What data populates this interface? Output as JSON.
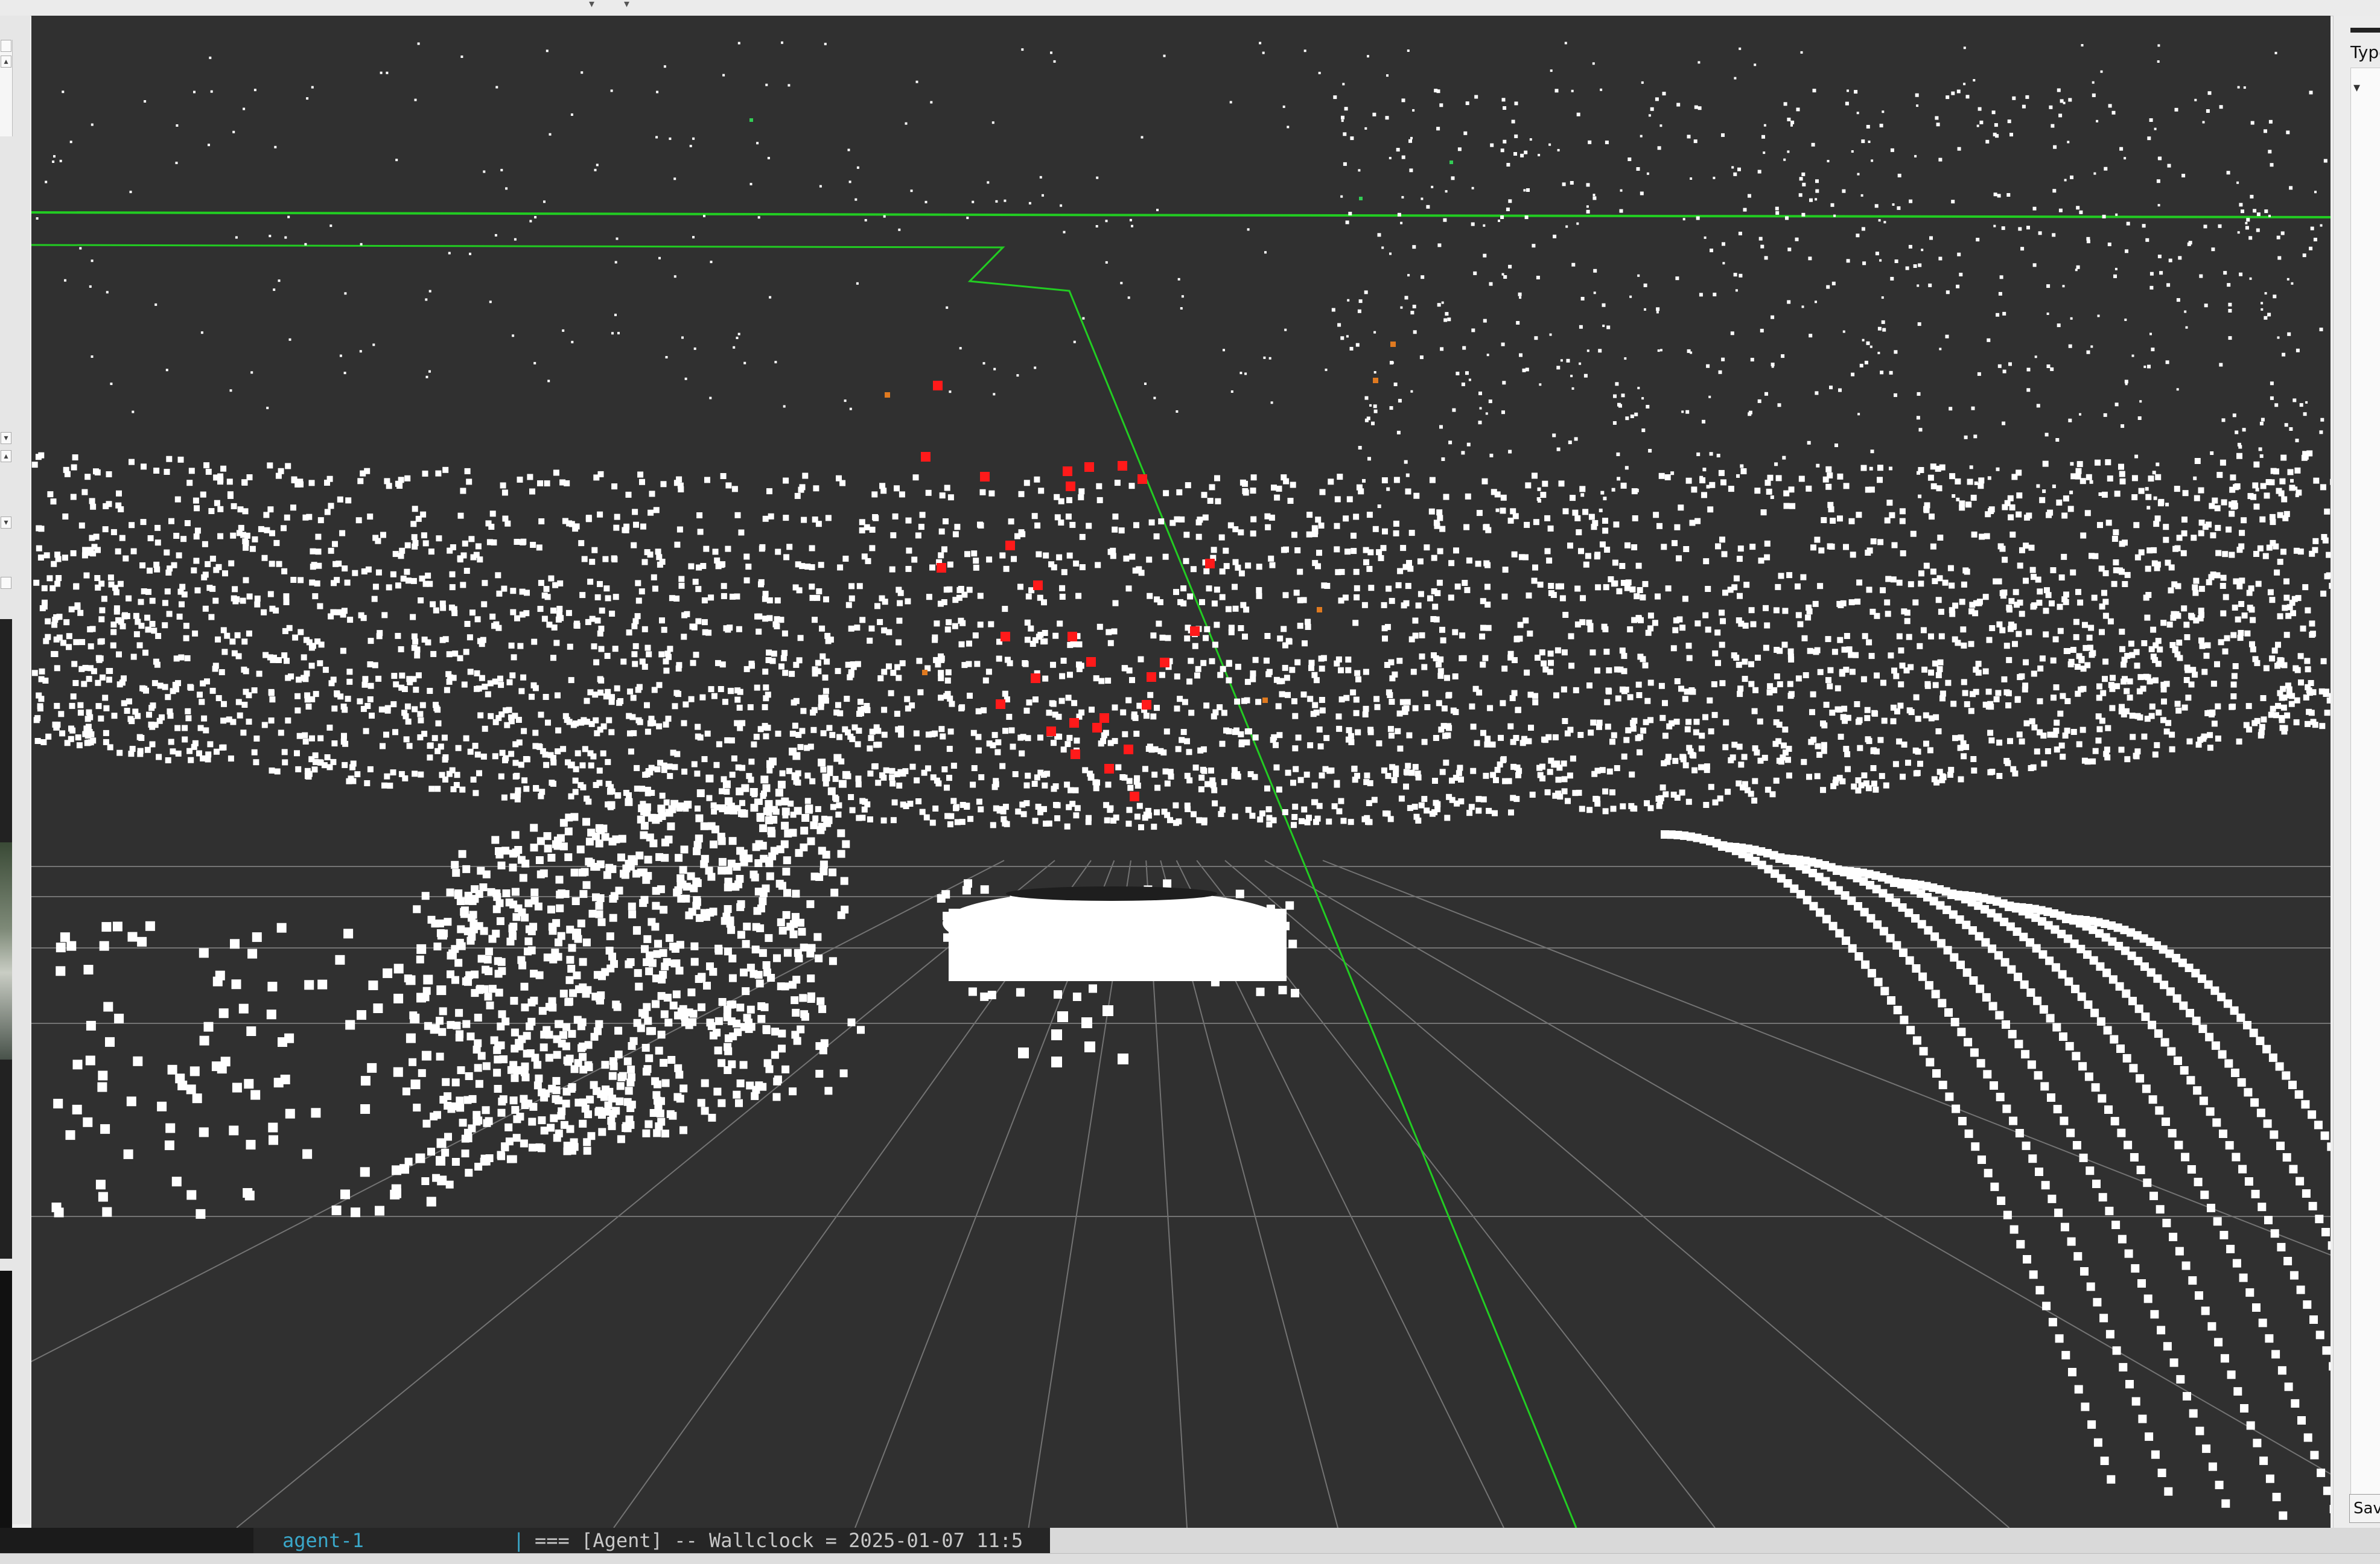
{
  "right_panel": {
    "type_label": "Type",
    "save_label": "Sav"
  },
  "console": {
    "node_name": "agent-1",
    "separator": "|",
    "message": "=== [Agent] -- Wallclock = 2025-01-07 11:5"
  },
  "viewport": {
    "background": "#303030",
    "grid_color": "#8a8a8a",
    "points_color": "#ffffff",
    "highlight_color": "#ff1a1a",
    "path_color": "#22cc22"
  }
}
